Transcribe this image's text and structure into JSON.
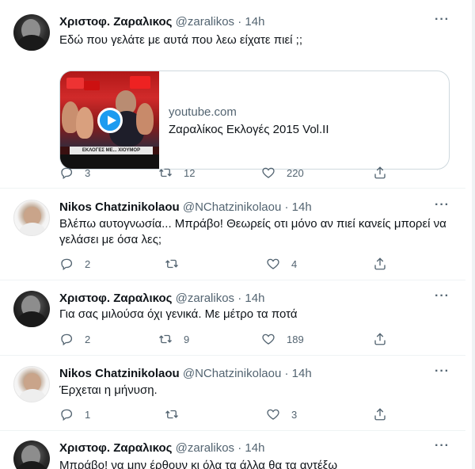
{
  "tweets": [
    {
      "name": "Χριστοφ. Ζαραλικος",
      "handle": "@zaralikos",
      "dot": "·",
      "time": "14h",
      "text": "Εδώ που γελάτε με αυτά που λεω είχατε πιεί ;;",
      "card": {
        "domain": "youtube.com",
        "title": "Ζαραλίκος Εκλογές 2015 Vol.II",
        "thumb_label": "ΕΚΛΟΓΕΣ ΜΕ... ΧΙΟΥΜΟΡ"
      },
      "replies": "3",
      "retweets": "12",
      "likes": "220"
    },
    {
      "name": "Nikos Chatzinikolaou",
      "handle": "@NChatzinikolaou",
      "dot": "·",
      "time": "14h",
      "text": "Βλέπω αυτογνωσία... Μπράβο! Θεωρείς οτι μόνο αν πιεί κανείς μπορεί να γελάσει με όσα λες;",
      "replies": "2",
      "retweets": "",
      "likes": "4"
    },
    {
      "name": "Χριστοφ. Ζαραλικος",
      "handle": "@zaralikos",
      "dot": "·",
      "time": "14h",
      "text": "Για σας μιλούσα όχι γενικά. Με μέτρο τα ποτά",
      "replies": "2",
      "retweets": "9",
      "likes": "189"
    },
    {
      "name": "Nikos Chatzinikolaou",
      "handle": "@NChatzinikolaou",
      "dot": "·",
      "time": "14h",
      "text": "Έρχεται η μήνυση.",
      "replies": "1",
      "retweets": "",
      "likes": "3"
    },
    {
      "name": "Χριστοφ. Ζαραλικος",
      "handle": "@zaralikos",
      "dot": "·",
      "time": "14h",
      "text": "Μπράβο! να μην έρθουν κι όλα τα άλλα θα τα αντέξω"
    }
  ],
  "icons": {
    "more": "more-horizontal-icon",
    "reply": "reply-icon",
    "retweet": "retweet-icon",
    "like": "heart-icon",
    "share": "share-icon",
    "play": "play-icon"
  },
  "colors": {
    "accent": "#1d9bf0",
    "secondary_text": "#536471",
    "primary_text": "#0f1419"
  }
}
